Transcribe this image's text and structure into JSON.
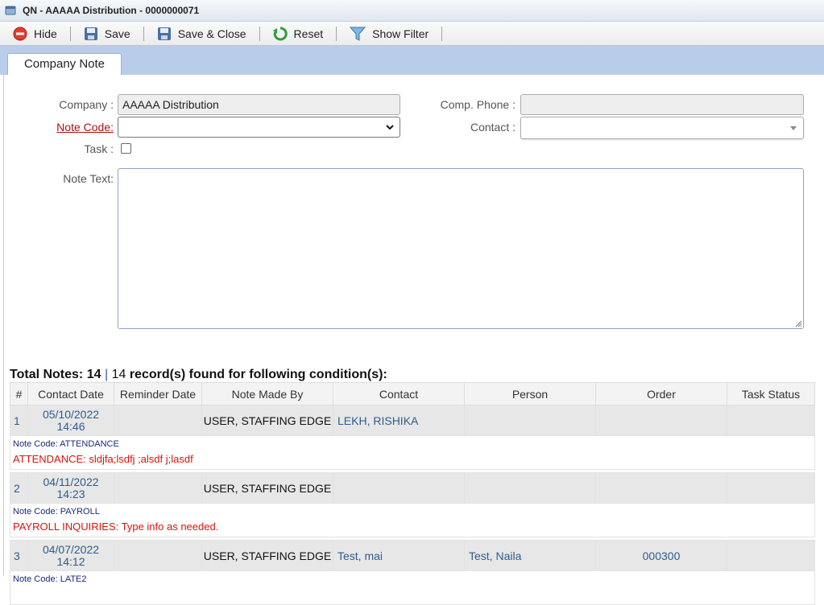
{
  "window": {
    "title": "QN - AAAAA Distribution - 0000000071"
  },
  "toolbar": {
    "hide": "Hide",
    "save": "Save",
    "save_close": "Save & Close",
    "reset": "Reset",
    "show_filter": "Show Filter"
  },
  "tabs": [
    {
      "label": "Company Note"
    }
  ],
  "form": {
    "company_label": "Company :",
    "company_value": "AAAAA Distribution",
    "note_code_label": "Note Code:",
    "note_code_value": "",
    "task_label": "Task :",
    "task_checked": false,
    "note_text_label": "Note Text:",
    "note_text_value": "",
    "comp_phone_label": "Comp. Phone :",
    "comp_phone_value": "",
    "contact_label": "Contact :",
    "contact_value": ""
  },
  "summary": {
    "total_label": "Total Notes: 14",
    "pipe": "|",
    "count": "14",
    "condition_text": "record(s) found for following condition(s):"
  },
  "table": {
    "columns": [
      "#",
      "Contact Date",
      "Reminder Date",
      "Note Made By",
      "Contact",
      "Person",
      "Order",
      "Task Status"
    ],
    "rows": [
      {
        "num": "1",
        "date": "05/10/2022",
        "time": "14:46",
        "reminder": "",
        "made_by": "USER, STAFFING EDGE",
        "contact": "LEKH, RISHIKA",
        "person": "",
        "order": "",
        "task_status": "",
        "note_code": "Note Code: ATTENDANCE",
        "note_text": "ATTENDANCE: sldjfa;lsdfj ;alsdf j;lasdf"
      },
      {
        "num": "2",
        "date": "04/11/2022",
        "time": "14:23",
        "reminder": "",
        "made_by": "USER, STAFFING EDGE",
        "contact": "",
        "person": "",
        "order": "",
        "task_status": "",
        "note_code": "Note Code: PAYROLL",
        "note_text": "PAYROLL INQUIRIES: Type info as needed."
      },
      {
        "num": "3",
        "date": "04/07/2022",
        "time": "14:12",
        "reminder": "",
        "made_by": "USER, STAFFING EDGE",
        "contact": "Test, mai",
        "person": "Test, Naila",
        "order": "000300",
        "task_status": "",
        "note_code": "Note Code: LATE2",
        "note_text": ""
      }
    ]
  },
  "colors": {
    "link": "#2f5c8e",
    "note_text": "#dd1111",
    "tab_strip": "#b9cdea",
    "required_label": "#aa1111"
  },
  "icons": [
    "app-window-icon",
    "hide-icon",
    "save-icon",
    "save-close-icon",
    "reset-icon",
    "filter-icon",
    "chevron-down-icon",
    "resize-grip-icon"
  ]
}
